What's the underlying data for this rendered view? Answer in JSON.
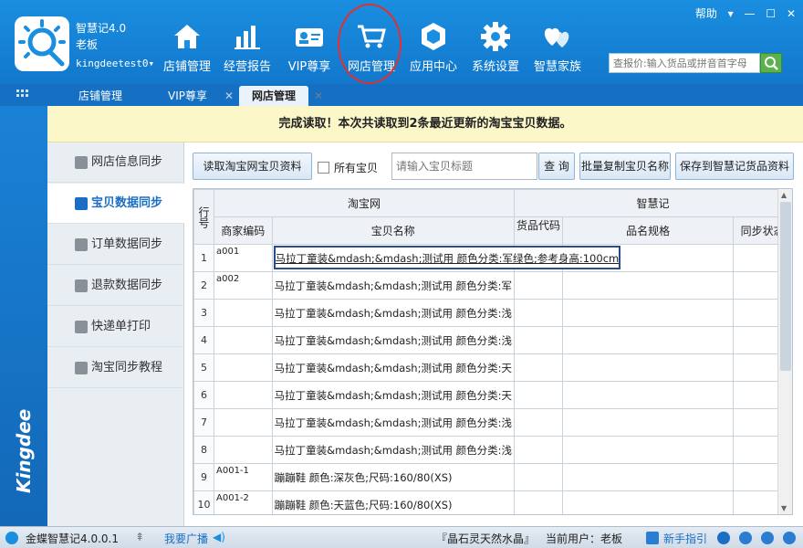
{
  "app": {
    "name": "智慧记4.0",
    "user_role": "老板",
    "account": "kingdeetest0▾"
  },
  "window_controls": {
    "help_label": "帮助",
    "menu_glyph": "▾",
    "minimize_glyph": "—",
    "maximize_glyph": "☐",
    "close_glyph": "✕"
  },
  "nav": [
    {
      "label": "店铺管理",
      "icon": "shop-icon"
    },
    {
      "label": "经营报告",
      "icon": "bar-chart-icon"
    },
    {
      "label": "VIP尊享",
      "icon": "vip-card-icon"
    },
    {
      "label": "网店管理",
      "icon": "shopping-cart-icon"
    },
    {
      "label": "应用中心",
      "icon": "cube-icon"
    },
    {
      "label": "系统设置",
      "icon": "gear-icon"
    },
    {
      "label": "智慧家族",
      "icon": "hearts-icon"
    }
  ],
  "search": {
    "placeholder": "查报价:输入货品或拼音首字母"
  },
  "tabs": [
    {
      "label": "店铺管理",
      "closable": false
    },
    {
      "label": "VIP尊享",
      "closable": true
    },
    {
      "label": "网店管理",
      "closable": true,
      "active": true
    }
  ],
  "brand": "Kingdee",
  "notice": "完成读取！本次共读取到2条最近更新的淘宝宝贝数据。",
  "sidemenu": [
    {
      "label": "网店信息同步",
      "icon": "shop-info-icon",
      "active": false
    },
    {
      "label": "宝贝数据同步",
      "icon": "pin-icon",
      "active": true
    },
    {
      "label": "订单数据同步",
      "icon": "document-icon",
      "active": false
    },
    {
      "label": "退款数据同步",
      "icon": "tag-icon",
      "active": false
    },
    {
      "label": "快递单打印",
      "icon": "printer-icon",
      "active": false
    },
    {
      "label": "淘宝同步教程",
      "icon": "piggy-icon",
      "active": false
    }
  ],
  "toolbar": {
    "read_button": "读取淘宝网宝贝资料",
    "all_items_label": "所有宝贝",
    "all_items_checked": false,
    "title_placeholder": "请输入宝贝标题",
    "query_button": "查 询",
    "batch_copy_button": "批量复制宝贝名称",
    "save_button": "保存到智慧记货品资料"
  },
  "grid": {
    "group_taobao": "淘宝网",
    "group_zhihuiji": "智慧记",
    "headers": {
      "row_no": "行号",
      "merchant_code": "商家编码",
      "item_name": "宝贝名称",
      "product_code": "货品代码",
      "spec": "品名规格",
      "sync_status": "同步状态"
    },
    "rows": [
      {
        "no": "1",
        "code": "a001",
        "name": "马拉丁童装&mdash;&mdash;测试用 颜色分类:军绿色;参考身高:100cm"
      },
      {
        "no": "2",
        "code": "a002",
        "name": "马拉丁童装&mdash;&mdash;测试用 颜色分类:军"
      },
      {
        "no": "3",
        "code": "",
        "name": "马拉丁童装&mdash;&mdash;测试用 颜色分类:浅"
      },
      {
        "no": "4",
        "code": "",
        "name": "马拉丁童装&mdash;&mdash;测试用 颜色分类:浅"
      },
      {
        "no": "5",
        "code": "",
        "name": "马拉丁童装&mdash;&mdash;测试用 颜色分类:天"
      },
      {
        "no": "6",
        "code": "",
        "name": "马拉丁童装&mdash;&mdash;测试用 颜色分类:天"
      },
      {
        "no": "7",
        "code": "",
        "name": "马拉丁童装&mdash;&mdash;测试用 颜色分类:浅"
      },
      {
        "no": "8",
        "code": "",
        "name": "马拉丁童装&mdash;&mdash;测试用 颜色分类:浅"
      },
      {
        "no": "9",
        "code": "A001-1",
        "name": "蹦蹦鞋 颜色:深灰色;尺码:160/80(XS)"
      },
      {
        "no": "10",
        "code": "A001-2",
        "name": "蹦蹦鞋 颜色:天蓝色;尺码:160/80(XS)"
      }
    ]
  },
  "statusbar": {
    "product": "金蝶智慧记4.0.0.1",
    "broadcast": "我要广播",
    "shop_name": "『晶石灵天然水晶』",
    "current_user_label": "当前用户：老板",
    "guide": "新手指引"
  },
  "colors": {
    "header_blue": "#1a8ee0",
    "notice_yellow": "#fbf7c8",
    "active_blue": "#1a6fc4",
    "annotation_red": "#e03030"
  }
}
